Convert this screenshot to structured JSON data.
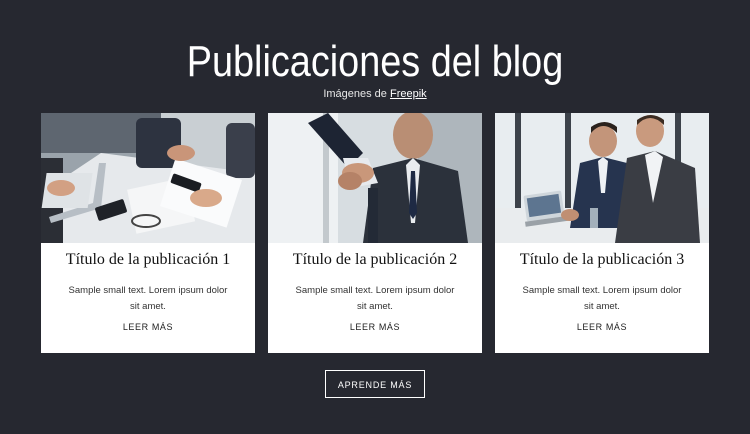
{
  "header": {
    "title": "Publicaciones del blog",
    "credit_prefix": "Imágenes de",
    "credit_link": "Freepik"
  },
  "posts": [
    {
      "title": "Título de la publicación 1",
      "text": "Sample small text. Lorem ipsum dolor sit amet.",
      "link": "LEER MÁS",
      "image": "business-team-meeting-photo"
    },
    {
      "title": "Título de la publicación 2",
      "text": "Sample small text. Lorem ipsum dolor sit amet.",
      "link": "LEER MÁS",
      "image": "business-handshake-photo"
    },
    {
      "title": "Título de la publicación 3",
      "text": "Sample small text. Lorem ipsum dolor sit amet.",
      "link": "LEER MÁS",
      "image": "businessmen-laptop-photo"
    }
  ],
  "cta": {
    "label": "APRENDE MÁS"
  },
  "colors": {
    "background": "#262830",
    "card": "#ffffff",
    "accent": "#ffffff"
  }
}
